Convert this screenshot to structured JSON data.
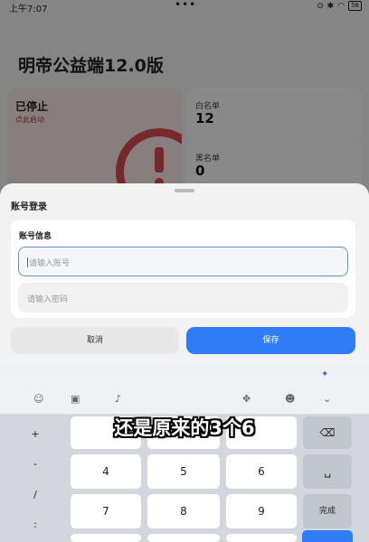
{
  "status_bar": {
    "time": "上午7:07",
    "dots": "•••",
    "battery": "58"
  },
  "app": {
    "title": "明帝公益端12.0版",
    "status_card": {
      "title": "已停止",
      "subtitle": "点此启动"
    },
    "whitelist": {
      "label": "白名单",
      "value": "12"
    },
    "blacklist": {
      "label": "黑名单",
      "value": "0"
    }
  },
  "dialog": {
    "title": "账号登录",
    "section_title": "账号信息",
    "account_placeholder": "请输入账号",
    "password_placeholder": "请输入密码",
    "cancel_label": "取消",
    "save_label": "保存"
  },
  "keyboard": {
    "symbols": [
      "+",
      "-",
      "/",
      ":"
    ],
    "row1": [
      "4",
      "5",
      "6"
    ],
    "row2": [
      "7",
      "8",
      "9"
    ],
    "done_label": "完成",
    "backspace": "⌫",
    "space": "␣"
  },
  "subtitle": "还是原来的3个6",
  "colors": {
    "accent": "#2f7cf6",
    "danger": "#d94a4a"
  }
}
